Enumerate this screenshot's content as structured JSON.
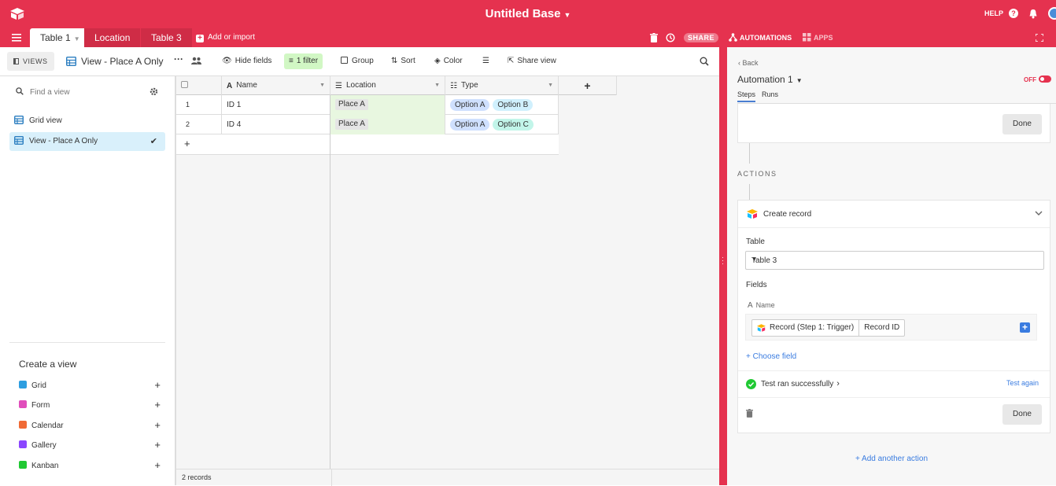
{
  "app": {
    "base_title": "Untitled Base",
    "help": "HELP"
  },
  "tabs": [
    {
      "label": "Table 1"
    },
    {
      "label": "Location"
    },
    {
      "label": "Table 3"
    }
  ],
  "add_import": "Add or import",
  "header_actions": {
    "share": "SHARE",
    "automations": "AUTOMATIONS",
    "apps": "APPS"
  },
  "toolbar": {
    "views": "VIEWS",
    "view_name": "View - Place A Only",
    "more": "···",
    "hide_fields": "Hide fields",
    "filter": "1 filter",
    "group": "Group",
    "sort": "Sort",
    "color": "Color",
    "share_view": "Share view"
  },
  "sidebar": {
    "find_placeholder": "Find a view",
    "views": [
      {
        "label": "Grid view"
      },
      {
        "label": "View - Place A Only"
      }
    ],
    "create_view": "Create a view",
    "create_items": [
      {
        "label": "Grid",
        "color": "#2d9ee0"
      },
      {
        "label": "Form",
        "color": "#e04dbb"
      },
      {
        "label": "Calendar",
        "color": "#f06a35"
      },
      {
        "label": "Gallery",
        "color": "#8b46ff"
      },
      {
        "label": "Kanban",
        "color": "#20c933"
      }
    ]
  },
  "grid": {
    "columns": [
      {
        "label": "Name",
        "icon": "text-field-icon"
      },
      {
        "label": "Location",
        "icon": "link-field-icon"
      },
      {
        "label": "Type",
        "icon": "multi-select-icon"
      }
    ],
    "rows": [
      {
        "num": "1",
        "name": "ID 1",
        "location": "Place A",
        "types": [
          "Option A",
          "Option B"
        ]
      },
      {
        "num": "2",
        "name": "ID 4",
        "location": "Place A",
        "types": [
          "Option A",
          "Option C"
        ]
      }
    ],
    "record_count": "2 records"
  },
  "automation": {
    "back": "Back",
    "title": "Automation 1",
    "toggle": "OFF",
    "tabs": [
      "Steps",
      "Runs"
    ],
    "done": "Done",
    "actions_label": "ACTIONS",
    "action_title": "Create record",
    "table_label": "Table",
    "table_value": "Table 3",
    "fields_label": "Fields",
    "name_field": "Name",
    "token_source": "Record (Step 1: Trigger)",
    "token_field": "Record ID",
    "choose_field": "+ Choose field",
    "test_status": "Test ran successfully",
    "test_again": "Test again",
    "add_action": "+ Add another action"
  },
  "colors": {
    "brand": "#e5324f",
    "filter_bg": "#d1f7c4",
    "selected_view_bg": "#d9f0fb",
    "link_blue": "#3a7ce0",
    "success": "#20c933"
  }
}
